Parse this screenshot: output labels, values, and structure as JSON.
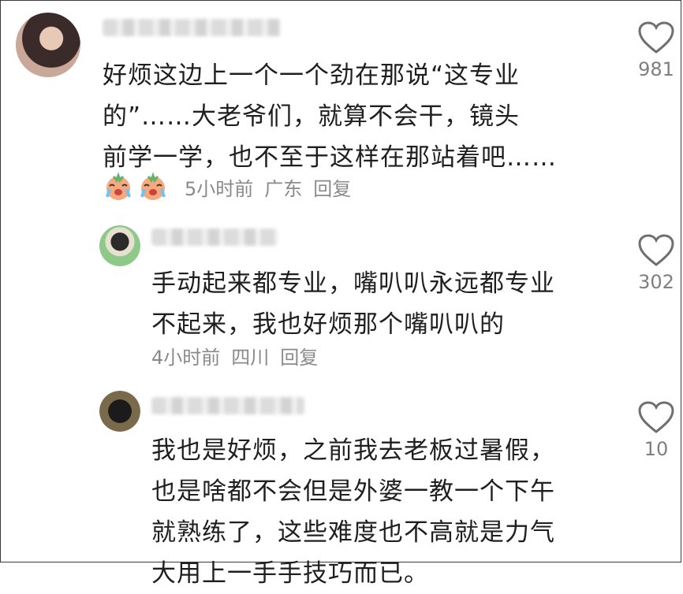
{
  "comments": [
    {
      "text": "好烦这边上一个一个劲在那说“这专业\n的”……大老爷们，就算不会干，镜头\n前学一学，也不至于这样在那站着吧……",
      "time": "5小时前",
      "location": "广东",
      "reply": "回复",
      "likes": "981",
      "emoji": "crying-face-emoji"
    },
    {
      "text": "手动起来都专业，嘴叭叭永远都专业\n不起来，我也好烦那个嘴叭叭的",
      "time": "4小时前",
      "location": "四川",
      "reply": "回复",
      "likes": "302"
    },
    {
      "text": "我也是好烦，之前我去老板过暑假，\n也是啥都不会但是外婆一教一个下午\n就熟练了，这些难度也不高就是力气\n大用上一手手技巧而已。",
      "likes": "10"
    }
  ],
  "icons": {
    "like": "heart-outline-icon"
  },
  "colors": {
    "meta": "#8a8a8a",
    "text": "#1f1f1f",
    "like_stroke": "#6f6f6f"
  }
}
